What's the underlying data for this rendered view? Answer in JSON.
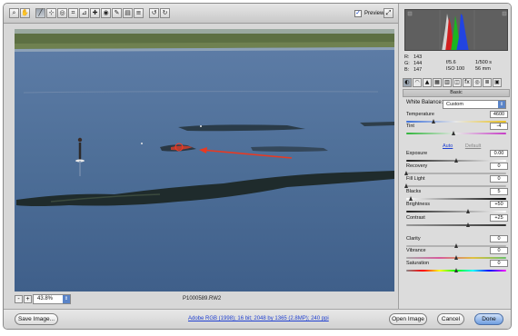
{
  "toolbar": {
    "tools": [
      {
        "name": "zoom-tool",
        "icon": "magnifier-icon",
        "glyph": "⌕"
      },
      {
        "name": "hand-tool",
        "icon": "hand-icon",
        "glyph": "✋"
      },
      {
        "name": "white-balance-tool",
        "icon": "eyedropper-icon",
        "glyph": "╱"
      },
      {
        "name": "color-sampler-tool",
        "icon": "color-sampler-icon",
        "glyph": "⊹"
      },
      {
        "name": "targeted-adjustment-tool",
        "icon": "target-adjust-icon",
        "glyph": "◎"
      },
      {
        "name": "crop-tool",
        "icon": "crop-icon",
        "glyph": "⌗"
      },
      {
        "name": "straighten-tool",
        "icon": "straighten-icon",
        "glyph": "⊿"
      },
      {
        "name": "spot-removal-tool",
        "icon": "spot-removal-icon",
        "glyph": "✚"
      },
      {
        "name": "red-eye-tool",
        "icon": "red-eye-icon",
        "glyph": "◉"
      },
      {
        "name": "adjustment-brush-tool",
        "icon": "brush-icon",
        "glyph": "✎"
      },
      {
        "name": "graduated-filter-tool",
        "icon": "gradient-icon",
        "glyph": "▤"
      },
      {
        "name": "preferences-tool",
        "icon": "preferences-icon",
        "glyph": "≡"
      },
      {
        "name": "rotate-ccw-tool",
        "icon": "rotate-left-icon",
        "glyph": "↺"
      },
      {
        "name": "rotate-cw-tool",
        "icon": "rotate-right-icon",
        "glyph": "↻"
      }
    ],
    "preview_label": "Preview",
    "preview_checked": true,
    "fullscreen_icon": "fullscreen-icon"
  },
  "zoom": {
    "minus": "-",
    "plus": "+",
    "value": "43.8%"
  },
  "filename": "P1000589.RW2",
  "bottom": {
    "save_label": "Save Image...",
    "workflow_link": "Adobe RGB (1998); 16 bit; 2048 by 1365 (2.8MP); 240 ppi",
    "open_label": "Open Image",
    "cancel_label": "Cancel",
    "done_label": "Done"
  },
  "readout": {
    "r_label": "R:",
    "r": "143",
    "g_label": "G:",
    "g": "144",
    "b_label": "B:",
    "b": "147",
    "aperture": "f/5.6",
    "shutter": "1/500 s",
    "iso": "ISO 100",
    "focal": "56 mm"
  },
  "panel": {
    "tab_icons": [
      "basic-icon",
      "tone-curve-icon",
      "detail-icon",
      "hsl-icon",
      "split-tone-icon",
      "lens-icon",
      "effects-icon",
      "camera-calibration-icon",
      "presets-icon",
      "snapshots-icon"
    ],
    "title": "Basic",
    "white_balance_label": "White Balance:",
    "white_balance_value": "Custom",
    "auto_label": "Auto",
    "default_label": "Default",
    "sliders": [
      {
        "name": "temperature",
        "label": "Temperature",
        "value": "4600",
        "pos": 0.28
      },
      {
        "name": "tint",
        "label": "Tint",
        "value": "-4",
        "pos": 0.48
      },
      {
        "name": "exposure",
        "label": "Exposure",
        "value": "0.00",
        "pos": 0.5
      },
      {
        "name": "recovery",
        "label": "Recovery",
        "value": "0",
        "pos": 0.0
      },
      {
        "name": "fill-light",
        "label": "Fill Light",
        "value": "0",
        "pos": 0.0
      },
      {
        "name": "blacks",
        "label": "Blacks",
        "value": "5",
        "pos": 0.05
      },
      {
        "name": "brightness",
        "label": "Brightness",
        "value": "+50",
        "pos": 0.62
      },
      {
        "name": "contrast",
        "label": "Contrast",
        "value": "+25",
        "pos": 0.62
      },
      {
        "name": "clarity",
        "label": "Clarity",
        "value": "0",
        "pos": 0.5
      },
      {
        "name": "vibrance",
        "label": "Vibrance",
        "value": "0",
        "pos": 0.5
      },
      {
        "name": "saturation",
        "label": "Saturation",
        "value": "0",
        "pos": 0.5
      }
    ]
  },
  "colors": {
    "water": "#4a6d97",
    "shore": "#5b6b3a",
    "annotation_red": "#e02818",
    "done_blue": "#6f9ee0"
  }
}
